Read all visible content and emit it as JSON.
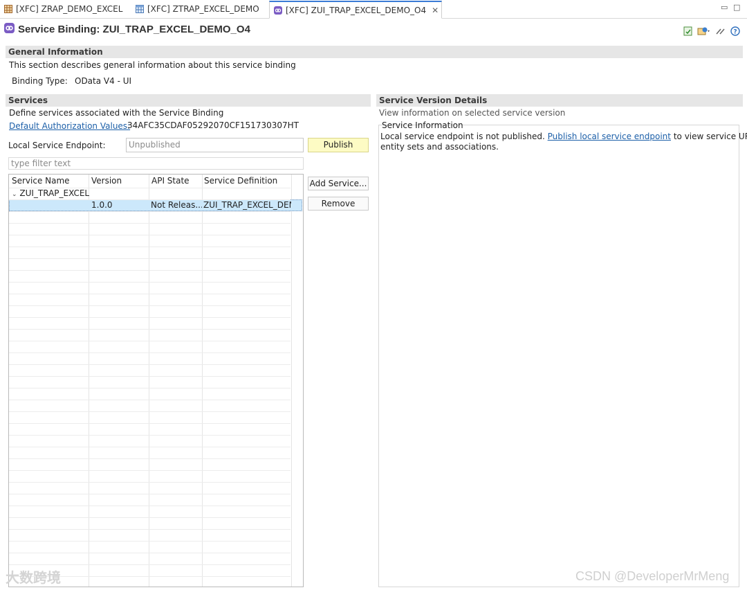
{
  "tabs": [
    {
      "label": "[XFC] ZRAP_DEMO_EXCEL",
      "icon": "table-grid-icon"
    },
    {
      "label": "[XFC] ZTRAP_EXCEL_DEMO",
      "icon": "table-icon"
    },
    {
      "label": "[XFC] ZUI_TRAP_EXCEL_DEMO_O4",
      "icon": "service-binding-icon",
      "active": true
    }
  ],
  "header": {
    "title": "Service Binding: ZUI_TRAP_EXCEL_DEMO_O4"
  },
  "general": {
    "heading": "General Information",
    "description": "This section describes general information about this service binding",
    "binding_type_label": "Binding Type:",
    "binding_type_value": "OData V4 - UI"
  },
  "services": {
    "heading": "Services",
    "description": "Define services associated with the Service Binding",
    "auth_link": "Default Authorization Values:",
    "auth_value": "34AFC35CDAF05292070CF151730307HT",
    "endpoint_label": "Local Service Endpoint:",
    "endpoint_placeholder": "Unpublished",
    "publish_button": "Publish",
    "filter_placeholder": "type filter text",
    "columns": [
      "Service Name",
      "Version",
      "API State",
      "Service Definition"
    ],
    "tree_node": "ZUI_TRAP_EXCEL_",
    "row": {
      "version": "1.0.0",
      "api_state": "Not Releas...",
      "definition": "ZUI_TRAP_EXCEL_DEM"
    },
    "add_button": "Add Service...",
    "remove_button": "Remove"
  },
  "details": {
    "heading": "Service Version Details",
    "description": "View information on selected service version",
    "group_label": "Service Information",
    "text_before": "Local service endpoint is not published.",
    "link": "Publish local service endpoint",
    "text_after": "to view service URL,",
    "text_line2": "entity sets and associations."
  },
  "watermarks": {
    "left": "大数跨境",
    "right": "CSDN @DeveloperMrMeng"
  },
  "colors": {
    "accent": "#3a7bd5",
    "link": "#1c5fa8",
    "publish_bg": "#fdfbc4",
    "selection": "#cce8fb"
  }
}
